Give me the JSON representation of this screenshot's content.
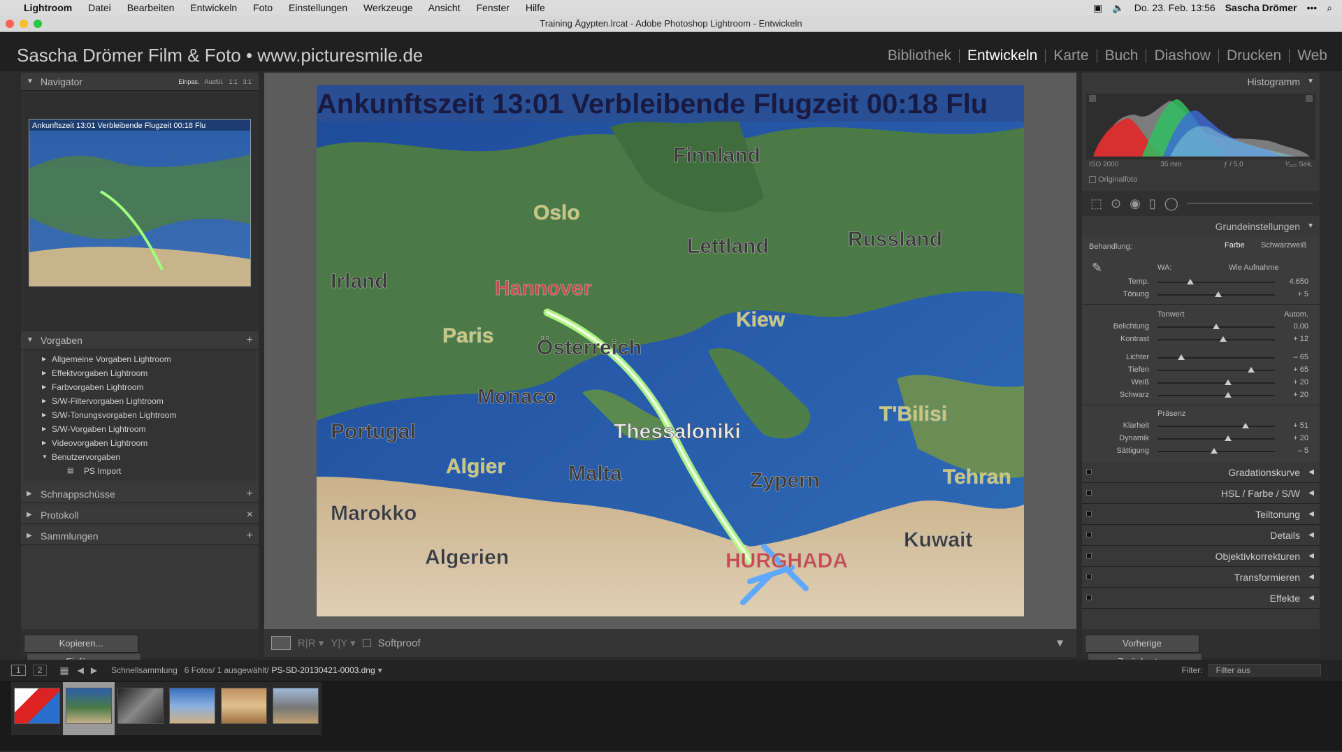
{
  "macbar": {
    "app": "Lightroom",
    "menus": [
      "Datei",
      "Bearbeiten",
      "Entwickeln",
      "Foto",
      "Einstellungen",
      "Werkzeuge",
      "Ansicht",
      "Fenster",
      "Hilfe"
    ],
    "clock": "Do. 23. Feb.  13:56",
    "user": "Sascha Drömer"
  },
  "window": {
    "title": "Training Ägypten.lrcat - Adobe Photoshop Lightroom - Entwickeln"
  },
  "identity": {
    "brand": "Sascha Drömer Film & Foto • www.picturesmile.de",
    "modules": [
      "Bibliothek",
      "Entwickeln",
      "Karte",
      "Buch",
      "Diashow",
      "Drucken",
      "Web"
    ],
    "active_module": "Entwickeln"
  },
  "navigator": {
    "title": "Navigator",
    "zoom": [
      "Einpas.",
      "Ausfül.",
      "1:1",
      "3:1"
    ]
  },
  "presets": {
    "title": "Vorgaben",
    "items": [
      "Allgemeine Vorgaben Lightroom",
      "Effektvorgaben Lightroom",
      "Farbvorgaben Lightroom",
      "S/W-Filtervorgaben Lightroom",
      "S/W-Tonungsvorgaben Lightroom",
      "S/W-Vorgaben Lightroom",
      "Videovorgaben Lightroom",
      "Benutzervorgaben"
    ],
    "sub_item": "PS Import"
  },
  "left_panels": {
    "snapshots": "Schnappschüsse",
    "history": "Protokoll",
    "collections": "Sammlungen"
  },
  "left_buttons": {
    "copy": "Kopieren...",
    "paste": "Einfügen"
  },
  "photo": {
    "top_text": "Ankunftszeit 13:01    Verbleibende Flugzeit 00:18    Flu",
    "places": [
      "Finnland",
      "Oslo",
      "Russland",
      "Lettland",
      "Irland",
      "Hannover",
      "Paris",
      "Österreich",
      "Kiew",
      "Monaco",
      "Thessaloniki",
      "Portugal",
      "T'Bilisi",
      "Algier",
      "Malta",
      "Zypern",
      "Tehran",
      "Marokko",
      "Kuwait",
      "Algerien",
      "HURGHADA"
    ]
  },
  "toolbar": {
    "softproof": "Softproof"
  },
  "histogram": {
    "title": "Histogramm",
    "iso": "ISO 2000",
    "focal": "35 mm",
    "aperture": "ƒ / 5,0",
    "shutter": "¹⁄₁₆₀ Sek.",
    "original": "Originalfoto"
  },
  "basic": {
    "title": "Grundeinstellungen",
    "treatment_label": "Behandlung:",
    "treatment_color": "Farbe",
    "treatment_bw": "Schwarzweiß",
    "wb_label": "WA:",
    "wb_value": "Wie Aufnahme",
    "tone": "Tonwert",
    "auto": "Autom.",
    "presence": "Präsenz",
    "wb_sliders": [
      {
        "name": "Temp.",
        "value": "4.650",
        "pos": 0.28
      },
      {
        "name": "Tönung",
        "value": "+ 5",
        "pos": 0.52
      }
    ],
    "tone_sliders": [
      {
        "name": "Belichtung",
        "value": "0,00",
        "pos": 0.5
      },
      {
        "name": "Kontrast",
        "value": "+ 12",
        "pos": 0.56
      }
    ],
    "tone_sliders2": [
      {
        "name": "Lichter",
        "value": "– 65",
        "pos": 0.2
      },
      {
        "name": "Tiefen",
        "value": "+ 65",
        "pos": 0.8
      },
      {
        "name": "Weiß",
        "value": "+ 20",
        "pos": 0.6
      },
      {
        "name": "Schwarz",
        "value": "+ 20",
        "pos": 0.6
      }
    ],
    "presence_sliders": [
      {
        "name": "Klarheit",
        "value": "+ 51",
        "pos": 0.75
      },
      {
        "name": "Dynamik",
        "value": "+ 20",
        "pos": 0.6
      },
      {
        "name": "Sättigung",
        "value": "– 5",
        "pos": 0.48
      }
    ]
  },
  "collapsed_panels": [
    "Gradationskurve",
    "HSL  /  Farbe  /  S/W",
    "Teiltonung",
    "Details",
    "Objektivkorrekturen",
    "Transformieren",
    "Effekte"
  ],
  "right_buttons": {
    "previous": "Vorherige",
    "reset": "Zurücksetzen"
  },
  "filmbar": {
    "page1": "1",
    "page2": "2",
    "source": "Schnellsammlung",
    "count": "6 Fotos/  1 ausgewählt/",
    "filename": "PS-SD-20130421-0003.dng",
    "filter_label": "Filter:",
    "filter_value": "Filter aus"
  }
}
